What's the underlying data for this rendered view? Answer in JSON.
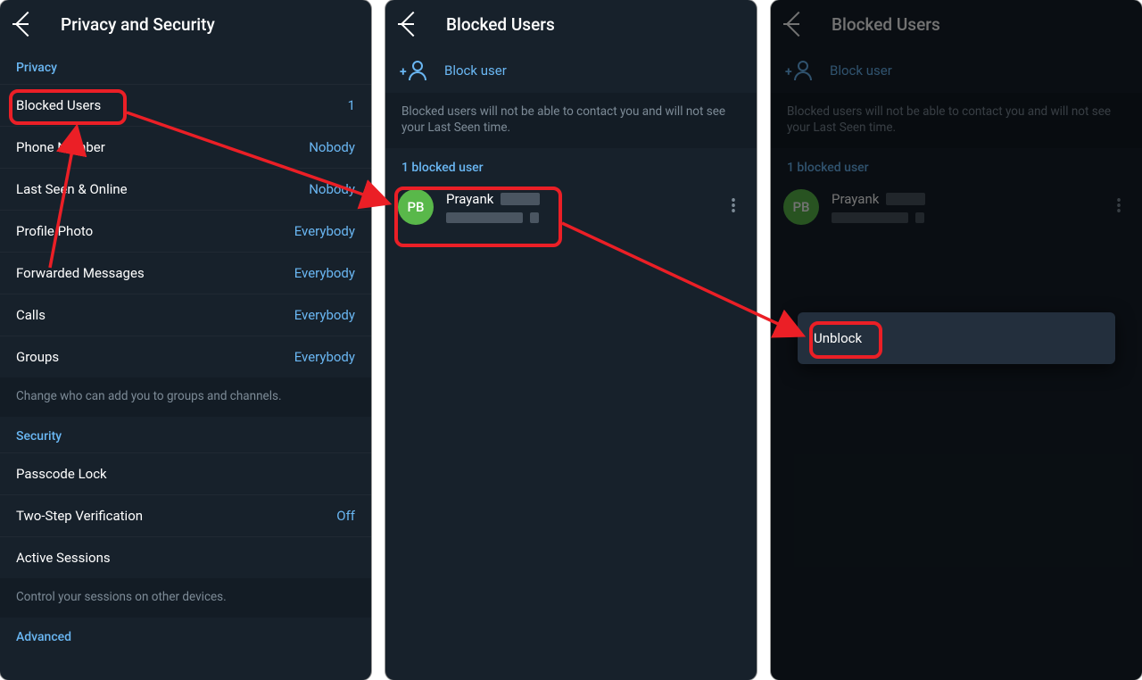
{
  "panel1": {
    "title": "Privacy and Security",
    "section_privacy": "Privacy",
    "items": [
      {
        "label": "Blocked Users",
        "value": "1"
      },
      {
        "label": "Phone Number",
        "value": "Nobody"
      },
      {
        "label": "Last Seen & Online",
        "value": "Nobody"
      },
      {
        "label": "Profile Photo",
        "value": "Everybody"
      },
      {
        "label": "Forwarded Messages",
        "value": "Everybody"
      },
      {
        "label": "Calls",
        "value": "Everybody"
      },
      {
        "label": "Groups",
        "value": "Everybody"
      }
    ],
    "privacy_note": "Change who can add you to groups and channels.",
    "section_security": "Security",
    "security_items": [
      {
        "label": "Passcode Lock",
        "value": ""
      },
      {
        "label": "Two-Step Verification",
        "value": "Off"
      },
      {
        "label": "Active Sessions",
        "value": ""
      }
    ],
    "security_note": "Control your sessions on other devices.",
    "section_advanced": "Advanced"
  },
  "panel2": {
    "title": "Blocked Users",
    "block_user_label": "Block user",
    "info": "Blocked users will not be able to contact you and will not see your Last Seen time.",
    "count_label": "1 blocked user",
    "user": {
      "initials": "PB",
      "name": "Prayank"
    }
  },
  "panel3": {
    "title": "Blocked Users",
    "block_user_label": "Block user",
    "info": "Blocked users will not be able to contact you and will not see your Last Seen time.",
    "count_label": "1 blocked user",
    "user": {
      "initials": "PB",
      "name": "Prayank"
    },
    "popup_item": "Unblock"
  }
}
